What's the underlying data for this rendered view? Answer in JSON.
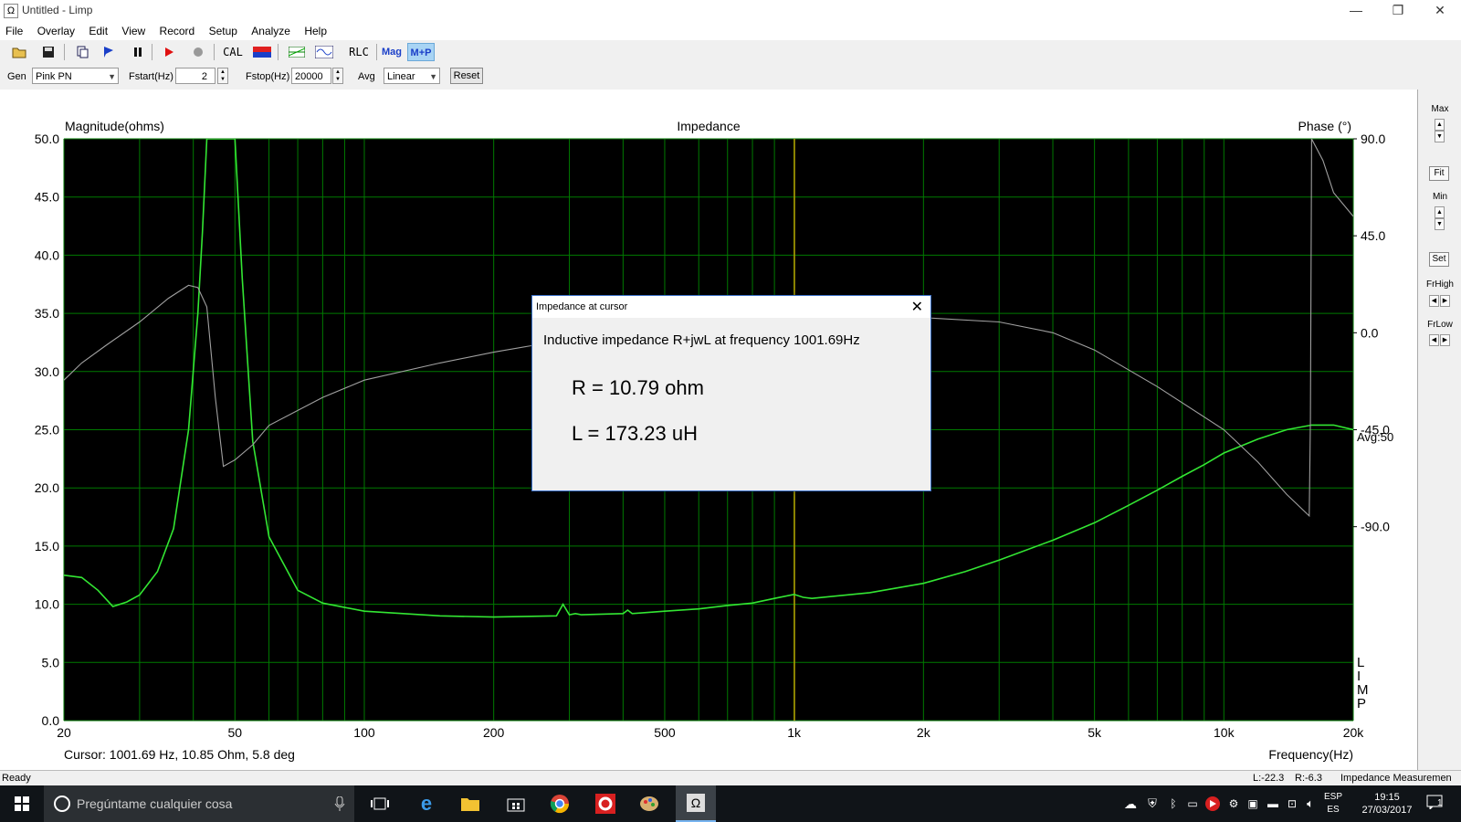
{
  "window": {
    "title": "Untitled - Limp",
    "icon": "omega-icon",
    "controls": [
      "—",
      "❐",
      "✕"
    ]
  },
  "menu": [
    "File",
    "Overlay",
    "Edit",
    "View",
    "Record",
    "Setup",
    "Analyze",
    "Help"
  ],
  "toolbar": {
    "cal": "CAL",
    "rlc": "RLC",
    "mag": "Mag",
    "mp": "M+P"
  },
  "gen": {
    "gen_label": "Gen",
    "gen_value": "Pink PN",
    "fstart_label": "Fstart(Hz)",
    "fstart_value": "2",
    "fstop_label": "Fstop(Hz)",
    "fstop_value": "20000",
    "avg_label": "Avg",
    "avg_value": "Linear",
    "reset": "Reset"
  },
  "right_panel": {
    "max": "Max",
    "fit": "Fit",
    "min": "Min",
    "set": "Set",
    "frhigh": "FrHigh",
    "frlow": "FrLow"
  },
  "chart": {
    "title": "Impedance",
    "ylabel_left": "Magnitude(ohms)",
    "ylabel_right": "Phase (°)",
    "xlabel": "Frequency(Hz)",
    "avg_label": "Avg:50",
    "brand": "LIMP",
    "cursor_text": "Cursor: 1001.69 Hz, 10.85 Ohm, 5.8 deg"
  },
  "chart_data": {
    "type": "line",
    "title": "Impedance",
    "xlabel": "Frequency(Hz)",
    "ylabel": "Magnitude(ohms)",
    "y2label": "Phase (°)",
    "x_scale": "log",
    "xlim": [
      20,
      20000
    ],
    "ylim": [
      0,
      50
    ],
    "y2lim": [
      -180,
      90
    ],
    "x_ticks": [
      20,
      50,
      100,
      200,
      500,
      1000,
      2000,
      5000,
      10000,
      20000
    ],
    "x_tick_labels": [
      "20",
      "50",
      "100",
      "200",
      "500",
      "1k",
      "2k",
      "5k",
      "10k",
      "20k"
    ],
    "y_ticks": [
      0,
      5,
      10,
      15,
      20,
      25,
      30,
      35,
      40,
      45,
      50
    ],
    "y_tick_labels": [
      "0.0",
      "5.0",
      "10.0",
      "15.0",
      "20.0",
      "25.0",
      "30.0",
      "35.0",
      "40.0",
      "45.0",
      "50.0"
    ],
    "y2_ticks": [
      90,
      45,
      0,
      -45,
      -90
    ],
    "y2_tick_labels": [
      "90.0",
      "45.0",
      "0.0",
      "-45.0",
      "-90.0"
    ],
    "grid": true,
    "cursor_x": 1001.69,
    "series": [
      {
        "color": "#33e633",
        "axis": "left",
        "x": [
          20,
          22,
          24,
          26,
          28,
          30,
          33,
          36,
          39,
          41,
          42,
          43,
          44,
          45,
          46,
          47,
          48,
          50,
          52,
          55,
          60,
          70,
          80,
          100,
          150,
          200,
          280,
          290,
          300,
          310,
          320,
          400,
          410,
          420,
          500,
          600,
          700,
          800,
          900,
          1000,
          1050,
          1100,
          1500,
          2000,
          2500,
          3000,
          4000,
          5000,
          6000,
          7000,
          8000,
          9000,
          10000,
          12000,
          14000,
          16000,
          18000,
          20000
        ],
        "y": [
          12.5,
          12.3,
          11.2,
          9.8,
          10.2,
          10.8,
          12.8,
          16.5,
          25,
          35,
          42,
          50,
          50,
          50,
          50,
          50,
          50,
          50,
          38,
          24,
          15.8,
          11.2,
          10.1,
          9.4,
          9,
          8.9,
          9,
          10,
          9.1,
          9.2,
          9.1,
          9.2,
          9.5,
          9.2,
          9.4,
          9.6,
          9.9,
          10.1,
          10.5,
          10.85,
          10.6,
          10.5,
          11,
          11.8,
          12.8,
          13.8,
          15.5,
          17,
          18.5,
          19.8,
          21,
          22,
          23,
          24.2,
          25,
          25.4,
          25.4,
          25
        ]
      },
      {
        "color": "#a0a0a0",
        "axis": "right",
        "x": [
          20,
          22,
          25,
          30,
          35,
          39,
          41,
          43,
          45,
          47,
          50,
          55,
          60,
          80,
          100,
          150,
          200,
          280,
          290,
          300,
          310,
          400,
          500,
          700,
          1000,
          1500,
          2000,
          3000,
          4000,
          5000,
          7000,
          10000,
          12000,
          14000,
          15800,
          15900,
          16000,
          17000,
          18000,
          20000
        ],
        "y": [
          -22,
          -14,
          -6,
          5,
          16,
          22,
          21,
          12,
          -30,
          -62,
          -59,
          -52,
          -43,
          -30,
          -22,
          -14,
          -9,
          -4,
          2,
          -3,
          0,
          1,
          3,
          5,
          6,
          7,
          7,
          5,
          0,
          -8,
          -25,
          -45,
          -60,
          -75,
          -85,
          -40,
          90,
          80,
          65,
          54
        ]
      }
    ]
  },
  "dialog": {
    "title": "Impedance at cursor",
    "message": "Inductive impedance R+jwL at frequency 1001.69Hz",
    "r_line": "R = 10.79 ohm",
    "l_line": "L = 173.23 uH"
  },
  "status": {
    "left": "Ready",
    "l_val": "L:-22.3",
    "r_val": "R:-6.3",
    "right": "Impedance Measuremen"
  },
  "taskbar": {
    "search_placeholder": "Pregúntame cualquier cosa",
    "lang_top": "ESP",
    "lang_bottom": "ES",
    "time": "19:15",
    "date": "27/03/2017",
    "notifications": "1"
  },
  "colors": {
    "plot_bg": "#000000",
    "grid": "#007a00",
    "magnitude": "#33e633",
    "phase": "#a0a0a0",
    "cursor": "#b8a000",
    "accent": "#3a70c8"
  }
}
